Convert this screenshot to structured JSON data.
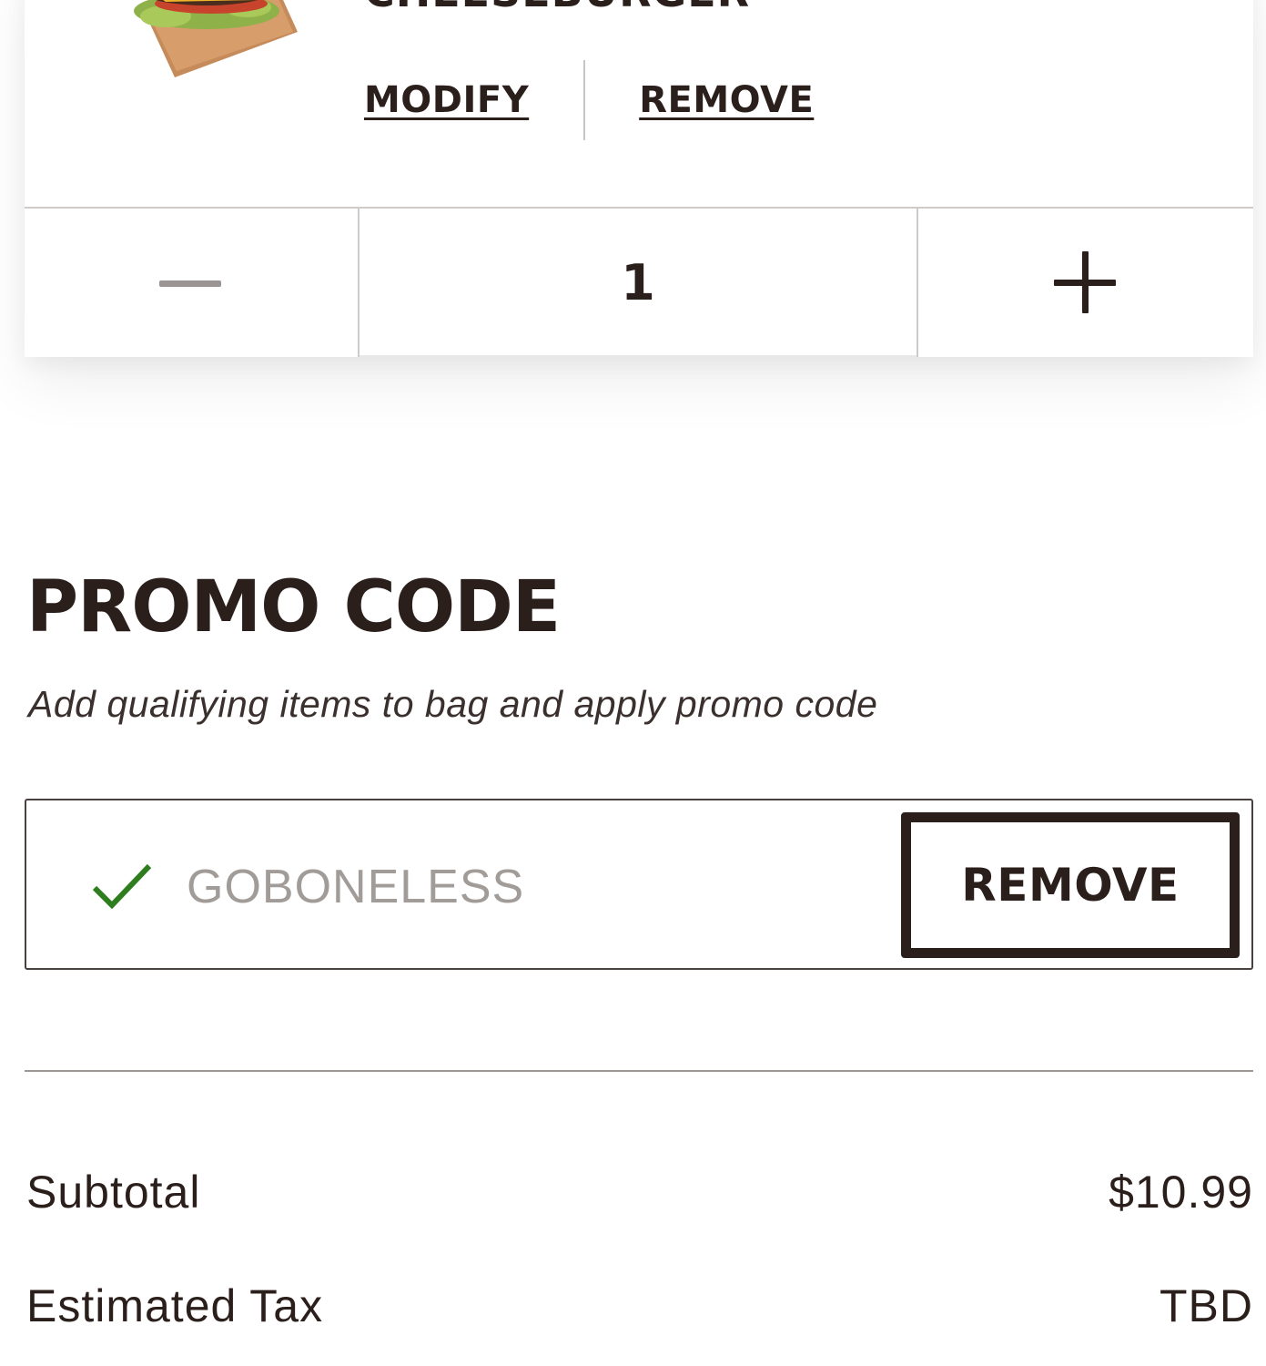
{
  "cart_item": {
    "name": "CHEESEBURGER",
    "image_alt": "cheeseburger",
    "modify_label": "MODIFY",
    "remove_label": "REMOVE",
    "quantity": "1",
    "decrement_symbol": "minus-icon",
    "increment_symbol": "plus-icon"
  },
  "promo": {
    "title": "PROMO CODE",
    "subtitle": "Add qualifying items to bag and apply promo code",
    "code_value": "GOBONELESS",
    "status_icon": "checkmark-icon",
    "remove_label": "REMOVE"
  },
  "totals": {
    "rows": [
      {
        "label": "Subtotal",
        "value": "$10.99"
      },
      {
        "label": "Estimated Tax",
        "value": "TBD"
      }
    ]
  },
  "colors": {
    "text": "#2b1f1c",
    "check_green": "#2e7d1e",
    "divider": "#cfcbc9",
    "placeholder_gray": "#a29c99"
  }
}
